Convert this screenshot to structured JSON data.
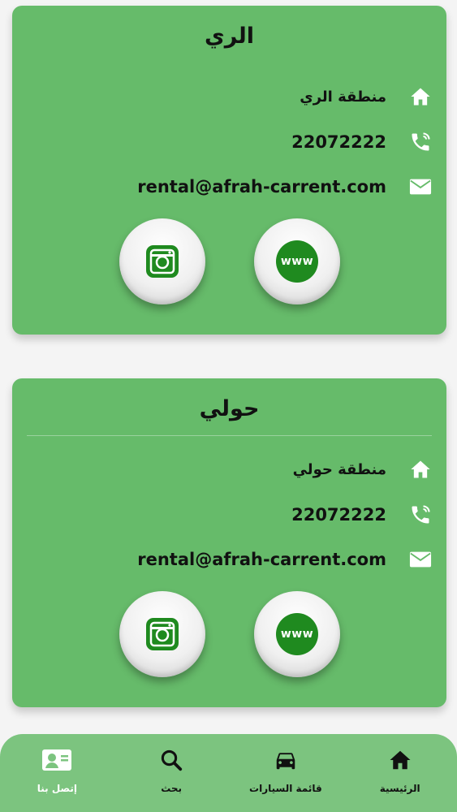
{
  "branches": [
    {
      "title": "الري",
      "address": "منطقة الري",
      "phone": "22072222",
      "email": "rental@afrah-carrent.com",
      "web_label": "www"
    },
    {
      "title": "حولي",
      "address": "منطقة حولي",
      "phone": "22072222",
      "email": "rental@afrah-carrent.com",
      "web_label": "www"
    }
  ],
  "nav": {
    "contact": "إتصل بنا",
    "search": "بحث",
    "cars": "قائمة السيارات",
    "home": "الرئيسية"
  },
  "colors": {
    "card": "#66bb6a",
    "nav": "#7cc47f",
    "badge": "#1f8a1f"
  }
}
